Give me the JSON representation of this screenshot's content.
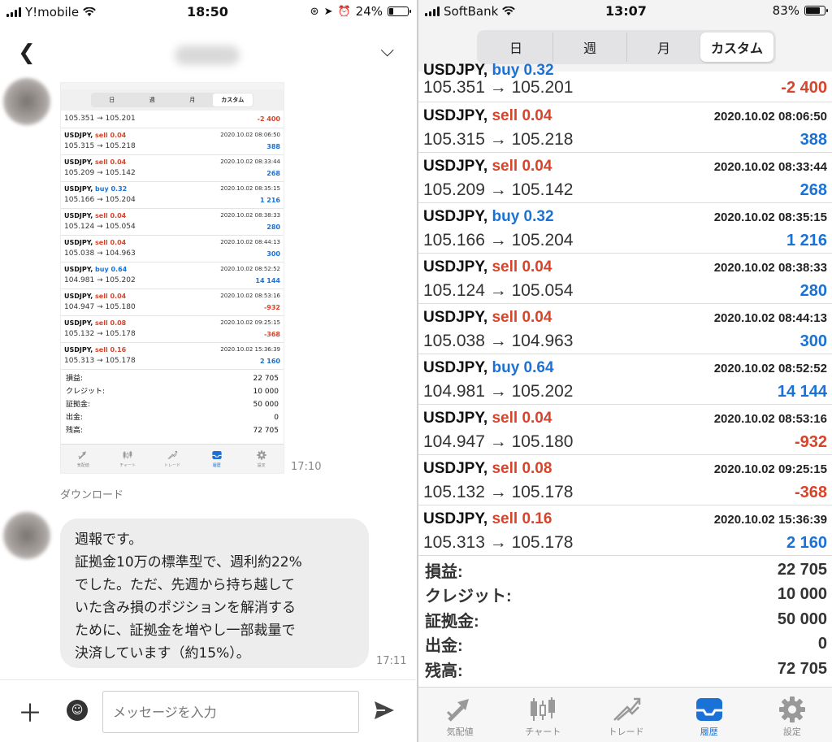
{
  "colors": {
    "sell": "#d8442a",
    "buy": "#1a72d6",
    "negative": "#d8442a",
    "positive": "#1a72d6",
    "tab_active": "#1a72d6"
  },
  "left": {
    "status": {
      "carrier": "Y!mobile",
      "time": "18:50",
      "battery": "24%",
      "battery_level": 0.24
    },
    "header": {
      "back_icon": "chevron-left-icon",
      "menu_icon": "chevron-down-icon"
    },
    "thumb_time": "17:10",
    "download_label": "ダウンロード",
    "message": {
      "lines": [
        "週報です。",
        "証拠金10万の標準型で、週利約22%",
        "でした。ただ、先週から持ち越して",
        "いた含み損のポジションを解消する",
        "ために、証拠金を増やし一部裁量で",
        "決済しています（約15%）。"
      ],
      "time": "17:11"
    },
    "composer": {
      "placeholder": "メッセージを入力"
    }
  },
  "right": {
    "status": {
      "carrier": "SoftBank",
      "time": "13:07",
      "battery": "83%",
      "battery_level": 0.83
    },
    "segments": [
      {
        "label": "日",
        "active": false
      },
      {
        "label": "週",
        "active": false
      },
      {
        "label": "月",
        "active": false
      },
      {
        "label": "カスタム",
        "active": true
      }
    ],
    "partial_row": {
      "symbol": "USDJPY,",
      "side": "buy",
      "lots": "0.32",
      "prices": "105.351 → 105.201",
      "pl": "-2 400",
      "pl_sign": "neg"
    },
    "trades": [
      {
        "symbol": "USDJPY,",
        "side": "sell",
        "lots": "0.04",
        "time": "2020.10.02 08:06:50",
        "prices": "105.315 → 105.218",
        "pl": "388",
        "pl_sign": "pos"
      },
      {
        "symbol": "USDJPY,",
        "side": "sell",
        "lots": "0.04",
        "time": "2020.10.02 08:33:44",
        "prices": "105.209 → 105.142",
        "pl": "268",
        "pl_sign": "pos"
      },
      {
        "symbol": "USDJPY,",
        "side": "buy",
        "lots": "0.32",
        "time": "2020.10.02 08:35:15",
        "prices": "105.166 → 105.204",
        "pl": "1 216",
        "pl_sign": "pos"
      },
      {
        "symbol": "USDJPY,",
        "side": "sell",
        "lots": "0.04",
        "time": "2020.10.02 08:38:33",
        "prices": "105.124 → 105.054",
        "pl": "280",
        "pl_sign": "pos"
      },
      {
        "symbol": "USDJPY,",
        "side": "sell",
        "lots": "0.04",
        "time": "2020.10.02 08:44:13",
        "prices": "105.038 → 104.963",
        "pl": "300",
        "pl_sign": "pos"
      },
      {
        "symbol": "USDJPY,",
        "side": "buy",
        "lots": "0.64",
        "time": "2020.10.02 08:52:52",
        "prices": "104.981 → 105.202",
        "pl": "14 144",
        "pl_sign": "pos"
      },
      {
        "symbol": "USDJPY,",
        "side": "sell",
        "lots": "0.04",
        "time": "2020.10.02 08:53:16",
        "prices": "104.947 → 105.180",
        "pl": "-932",
        "pl_sign": "neg"
      },
      {
        "symbol": "USDJPY,",
        "side": "sell",
        "lots": "0.08",
        "time": "2020.10.02 09:25:15",
        "prices": "105.132 → 105.178",
        "pl": "-368",
        "pl_sign": "neg"
      },
      {
        "symbol": "USDJPY,",
        "side": "sell",
        "lots": "0.16",
        "time": "2020.10.02 15:36:39",
        "prices": "105.313 → 105.178",
        "pl": "2 160",
        "pl_sign": "pos"
      }
    ],
    "summary": [
      {
        "label": "損益:",
        "value": "22 705"
      },
      {
        "label": "クレジット:",
        "value": "10 000"
      },
      {
        "label": "証拠金:",
        "value": "50 000"
      },
      {
        "label": "出金:",
        "value": "0"
      },
      {
        "label": "残高:",
        "value": "72 705"
      }
    ],
    "tabs": [
      {
        "label": "気配値",
        "icon": "quotes-icon",
        "active": false
      },
      {
        "label": "チャート",
        "icon": "chart-candles-icon",
        "active": false
      },
      {
        "label": "トレード",
        "icon": "trade-icon",
        "active": false
      },
      {
        "label": "履歴",
        "icon": "history-tray-icon",
        "active": true
      },
      {
        "label": "設定",
        "icon": "gear-icon",
        "active": false
      }
    ]
  }
}
